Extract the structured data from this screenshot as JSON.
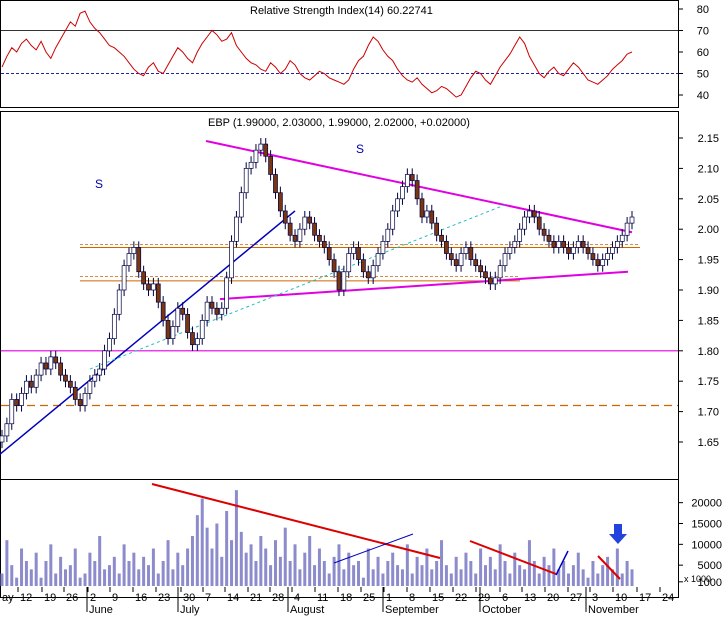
{
  "chart_data": [
    {
      "panel": "indicator",
      "type": "line",
      "title": "Relative Strength Index(14) 60.22741",
      "ylim": [
        30,
        85
      ],
      "y_ticks": [
        "80",
        "70",
        "60",
        "50",
        "40"
      ],
      "reference_levels": [
        {
          "value": 70,
          "color": "#333333",
          "style": "solid"
        },
        {
          "value": 50,
          "color": "#2222aa",
          "style": "dashed"
        }
      ],
      "series": [
        {
          "color": "#cc0000",
          "values": [
            53,
            58,
            62,
            60,
            64,
            66,
            63,
            61,
            65,
            60,
            57,
            62,
            66,
            70,
            74,
            72,
            78,
            79,
            74,
            71,
            69,
            66,
            63,
            62,
            60,
            58,
            55,
            52,
            50,
            49,
            53,
            55,
            51,
            50,
            54,
            58,
            62,
            60,
            57,
            55,
            60,
            64,
            67,
            70,
            68,
            65,
            66,
            69,
            63,
            60,
            57,
            55,
            54,
            52,
            51,
            55,
            53,
            50,
            52,
            56,
            54,
            50,
            48,
            47,
            49,
            51,
            50,
            48,
            47,
            46,
            45,
            47,
            52,
            56,
            58,
            63,
            67,
            65,
            61,
            58,
            56,
            52,
            49,
            47,
            46,
            48,
            45,
            43,
            41,
            42,
            44,
            43,
            41,
            39,
            40,
            44,
            48,
            51,
            50,
            47,
            45,
            49,
            53,
            56,
            59,
            63,
            67,
            64,
            58,
            54,
            50,
            48,
            51,
            53,
            50,
            49,
            52,
            55,
            53,
            50,
            47,
            46,
            45,
            47,
            49,
            52,
            54,
            56,
            59,
            60
          ]
        }
      ]
    },
    {
      "panel": "price",
      "type": "ohlc",
      "title": "EBP (1.99000, 2.03000, 1.99000, 2.02000, +0.02000)",
      "ylim": [
        1.6,
        2.2
      ],
      "y_ticks": [
        "2.15",
        "2.10",
        "2.05",
        "2.00",
        "1.95",
        "1.90",
        "1.85",
        "1.80",
        "1.75",
        "1.70",
        "1.65"
      ],
      "annotations": [
        "S",
        "S"
      ],
      "close": [
        1.66,
        1.68,
        1.72,
        1.71,
        1.73,
        1.75,
        1.74,
        1.76,
        1.78,
        1.77,
        1.79,
        1.78,
        1.76,
        1.75,
        1.74,
        1.72,
        1.71,
        1.73,
        1.75,
        1.76,
        1.77,
        1.8,
        1.82,
        1.86,
        1.9,
        1.94,
        1.96,
        1.97,
        1.93,
        1.91,
        1.9,
        1.91,
        1.88,
        1.85,
        1.82,
        1.84,
        1.87,
        1.86,
        1.83,
        1.81,
        1.82,
        1.85,
        1.88,
        1.87,
        1.86,
        1.87,
        1.92,
        1.98,
        2.02,
        2.06,
        2.1,
        2.11,
        2.13,
        2.14,
        2.12,
        2.09,
        2.06,
        2.03,
        2.01,
        1.99,
        1.98,
        2.0,
        2.02,
        2.01,
        1.99,
        1.98,
        1.97,
        1.95,
        1.93,
        1.9,
        1.93,
        1.96,
        1.97,
        1.95,
        1.93,
        1.92,
        1.94,
        1.96,
        1.98,
        2.0,
        2.03,
        2.05,
        2.07,
        2.09,
        2.08,
        2.05,
        2.02,
        2.03,
        2.01,
        1.99,
        1.98,
        1.96,
        1.95,
        1.94,
        1.96,
        1.97,
        1.95,
        1.94,
        1.93,
        1.92,
        1.91,
        1.92,
        1.94,
        1.96,
        1.97,
        1.98,
        2.0,
        2.02,
        2.03,
        2.02,
        2.0,
        1.99,
        1.98,
        1.97,
        1.98,
        1.97,
        1.96,
        1.97,
        1.98,
        1.97,
        1.96,
        1.95,
        1.94,
        1.95,
        1.96,
        1.97,
        1.98,
        1.99,
        2.01,
        2.02
      ]
    },
    {
      "panel": "volume",
      "type": "bar",
      "ylim": [
        0,
        24000
      ],
      "y_ticks": [
        "20000",
        "15000",
        "10000",
        "5000",
        "1000"
      ],
      "y_unit": "x 1000",
      "values": [
        3000,
        11000,
        5000,
        2000,
        9000,
        6000,
        4000,
        8000,
        2000,
        6000,
        10000,
        3000,
        7000,
        4000,
        5000,
        9000,
        2000,
        3000,
        8000,
        6000,
        12000,
        4000,
        5000,
        7000,
        3000,
        10000,
        6000,
        8000,
        4000,
        7000,
        5000,
        9000,
        3000,
        6000,
        11000,
        4000,
        8000,
        5000,
        9000,
        12000,
        17000,
        21000,
        14000,
        9000,
        15000,
        7000,
        18000,
        11000,
        23000,
        13000,
        8000,
        10000,
        6000,
        12000,
        9000,
        5000,
        11000,
        7000,
        14000,
        6000,
        10000,
        4000,
        8000,
        12000,
        5000,
        9000,
        6000,
        3000,
        7000,
        10000,
        4000,
        8000,
        5000,
        6000,
        2000,
        9000,
        4000,
        7000,
        3000,
        6000,
        8000,
        5000,
        4000,
        10000,
        3000,
        7000,
        5000,
        9000,
        4000,
        6000,
        11000,
        5000,
        3000,
        7000,
        4000,
        8000,
        6000,
        3000,
        9000,
        5000,
        7000,
        4000,
        10000,
        6000,
        3000,
        8000,
        5000,
        4000,
        11000,
        6000,
        3000,
        7000,
        5000,
        9000,
        4000,
        6000,
        3000,
        5000,
        8000,
        4000,
        2000,
        6000,
        3000,
        5000,
        7000,
        4000,
        9000,
        3000,
        6000,
        4000
      ]
    }
  ],
  "x_axis": {
    "day_ticks": [
      "ay",
      "12",
      "19",
      "26",
      "2",
      "9",
      "16",
      "23",
      "30",
      "7",
      "14",
      "21",
      "28",
      "4",
      "11",
      "18",
      "25",
      "1",
      "8",
      "15",
      "22",
      "29",
      "6",
      "13",
      "20",
      "27",
      "3",
      "10",
      "17",
      "24"
    ],
    "months": [
      "June",
      "July",
      "August",
      "September",
      "October",
      "November"
    ]
  },
  "colors": {
    "up_bar": "#ffffff",
    "down_bar": "#7a3511",
    "bar_outline": "#000040",
    "trendline_magenta": "#e000e0",
    "trendline_blue": "#0000bb",
    "support_orange": "#cc6600",
    "volume_bar": "#8c8ccc",
    "volume_trend_red": "#dd0000",
    "arrow_blue": "#2244dd"
  }
}
